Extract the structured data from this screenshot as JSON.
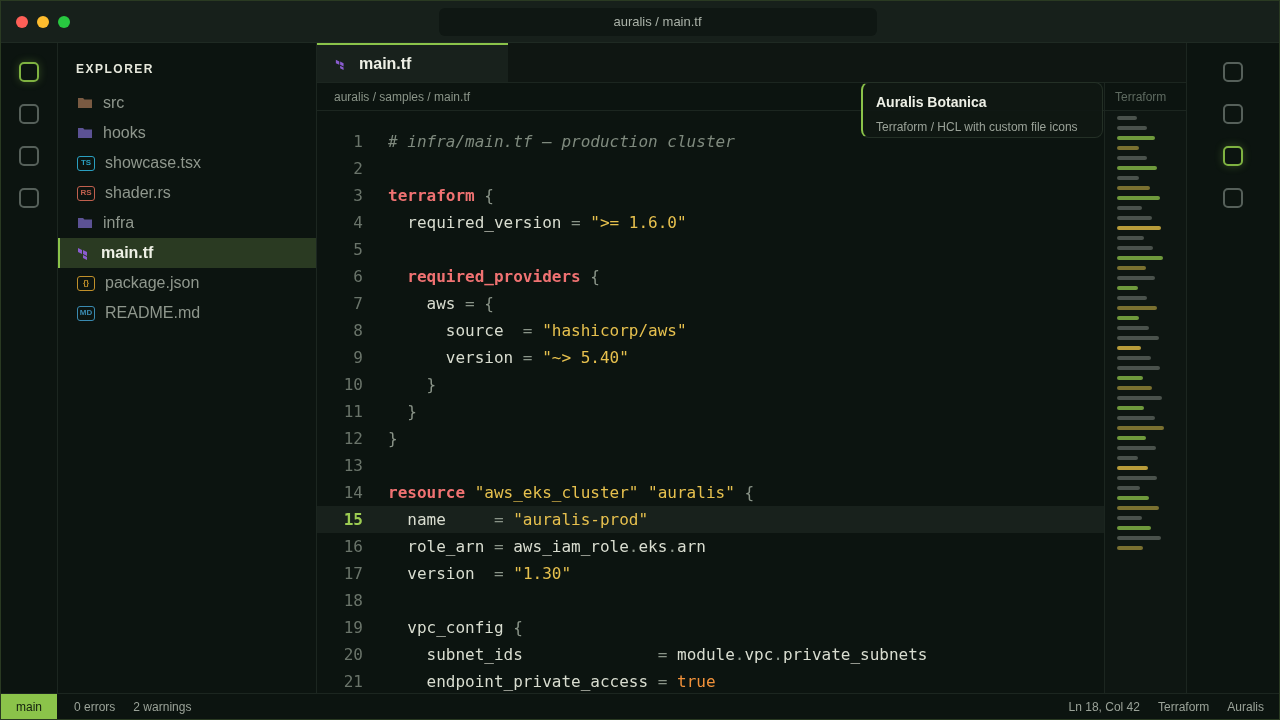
{
  "window": {
    "title": "auralis / main.tf"
  },
  "activity_left": [
    {
      "selected": true
    },
    {
      "selected": false
    },
    {
      "selected": false
    },
    {
      "selected": false
    }
  ],
  "activity_right": [
    {
      "selected": false
    },
    {
      "selected": false
    },
    {
      "selected": true
    },
    {
      "selected": false
    }
  ],
  "explorer": {
    "title": "EXPLORER",
    "items": [
      {
        "name": "src",
        "kind": "folder",
        "color": "#7a5a42",
        "selected": false
      },
      {
        "name": "hooks",
        "kind": "folder",
        "color": "#5c5294",
        "selected": false
      },
      {
        "name": "showcase.tsx",
        "kind": "file",
        "badge": "TS",
        "color": "#2a9fc0",
        "selected": false
      },
      {
        "name": "shader.rs",
        "kind": "file",
        "badge": "RS",
        "color": "#c0604e",
        "selected": false
      },
      {
        "name": "infra",
        "kind": "folder",
        "color": "#5c5294",
        "selected": false
      },
      {
        "name": "main.tf",
        "kind": "terraform",
        "color": "#8a5cd0",
        "selected": true
      },
      {
        "name": "package.json",
        "kind": "file",
        "badge": "{}",
        "color": "#c0902a",
        "selected": false
      },
      {
        "name": "README.md",
        "kind": "file",
        "badge": "MD",
        "color": "#3a8ab0",
        "selected": false
      }
    ]
  },
  "tabs": [
    {
      "label": "main.tf",
      "selected": true
    }
  ],
  "breadcrumb": "auralis / samples / main.tf",
  "minimap_label": "Terraform",
  "tooltip": {
    "title": "Auralis Botanica",
    "subtitle": "Terraform / HCL with custom file icons"
  },
  "code": [
    {
      "number": "1",
      "current": false,
      "tokens": [
        {
          "kind": "comment",
          "text": "# infra/main.tf – production cluster"
        }
      ]
    },
    {
      "number": "2",
      "current": false
    },
    {
      "number": "3",
      "current": false,
      "tokens": [
        {
          "kind": "keyword",
          "text": "terraform"
        },
        {
          "kind": "punct",
          "text": " {"
        }
      ]
    },
    {
      "number": "4",
      "current": false,
      "tokens": [
        {
          "kind": "plain",
          "text": "  required_version"
        },
        {
          "kind": "punct",
          "text": " ="
        },
        {
          "kind": "string",
          "text": " \">= 1.6.0\""
        }
      ]
    },
    {
      "number": "5",
      "current": false
    },
    {
      "number": "6",
      "current": false,
      "tokens": [
        {
          "kind": "keyword",
          "text": "  required_providers"
        },
        {
          "kind": "punct",
          "text": " {"
        }
      ]
    },
    {
      "number": "7",
      "current": false,
      "tokens": [
        {
          "kind": "plain",
          "text": "    aws"
        },
        {
          "kind": "punct",
          "text": " = {"
        }
      ]
    },
    {
      "number": "8",
      "current": false,
      "tokens": [
        {
          "kind": "plain",
          "text": "      source"
        },
        {
          "kind": "punct",
          "text": "  ="
        },
        {
          "kind": "string",
          "text": " \"hashicorp/aws\""
        }
      ]
    },
    {
      "number": "9",
      "current": false,
      "tokens": [
        {
          "kind": "plain",
          "text": "      version"
        },
        {
          "kind": "punct",
          "text": " ="
        },
        {
          "kind": "string",
          "text": " \"~> 5.40\""
        }
      ]
    },
    {
      "number": "10",
      "current": false,
      "tokens": [
        {
          "kind": "punct",
          "text": "    }"
        }
      ]
    },
    {
      "number": "11",
      "current": false,
      "tokens": [
        {
          "kind": "punct",
          "text": "  }"
        }
      ]
    },
    {
      "number": "12",
      "current": false,
      "tokens": [
        {
          "kind": "punct",
          "text": "}"
        }
      ]
    },
    {
      "number": "13",
      "current": false
    },
    {
      "number": "14",
      "current": false,
      "tokens": [
        {
          "kind": "keyword",
          "text": "resource"
        },
        {
          "kind": "string",
          "text": " \"aws_eks_cluster\" \"auralis\""
        },
        {
          "kind": "punct",
          "text": " {"
        }
      ]
    },
    {
      "number": "15",
      "current": true,
      "tokens": [
        {
          "kind": "plain",
          "text": "  name"
        },
        {
          "kind": "punct",
          "text": "     ="
        },
        {
          "kind": "string",
          "text": " \"auralis-prod\""
        }
      ]
    },
    {
      "number": "16",
      "current": false,
      "tokens": [
        {
          "kind": "plain",
          "text": "  role_arn"
        },
        {
          "kind": "punct",
          "text": " ="
        },
        {
          "kind": "plain",
          "text": " aws_iam_role"
        },
        {
          "kind": "punct",
          "text": "."
        },
        {
          "kind": "plain",
          "text": "eks"
        },
        {
          "kind": "punct",
          "text": "."
        },
        {
          "kind": "plain",
          "text": "arn"
        }
      ]
    },
    {
      "number": "17",
      "current": false,
      "tokens": [
        {
          "kind": "plain",
          "text": "  version"
        },
        {
          "kind": "punct",
          "text": "  ="
        },
        {
          "kind": "string",
          "text": " \"1.30\""
        }
      ]
    },
    {
      "number": "18",
      "current": false
    },
    {
      "number": "19",
      "current": false,
      "tokens": [
        {
          "kind": "plain",
          "text": "  vpc_config"
        },
        {
          "kind": "punct",
          "text": " {"
        }
      ]
    },
    {
      "number": "20",
      "current": false,
      "tokens": [
        {
          "kind": "plain",
          "text": "    subnet_ids"
        },
        {
          "kind": "punct",
          "text": "              ="
        },
        {
          "kind": "plain",
          "text": " module"
        },
        {
          "kind": "punct",
          "text": "."
        },
        {
          "kind": "plain",
          "text": "vpc"
        },
        {
          "kind": "punct",
          "text": "."
        },
        {
          "kind": "plain",
          "text": "private_subnets"
        }
      ]
    },
    {
      "number": "21",
      "current": false,
      "tokens": [
        {
          "kind": "plain",
          "text": "    endpoint_private_access"
        },
        {
          "kind": "punct",
          "text": " ="
        },
        {
          "kind": "bool",
          "text": " true"
        }
      ]
    }
  ],
  "status_bar": {
    "branch": "main",
    "errors": "0 errors",
    "warnings": "2 warnings",
    "position": "Ln 18, Col 42",
    "language": "Terraform",
    "theme": "Auralis"
  }
}
